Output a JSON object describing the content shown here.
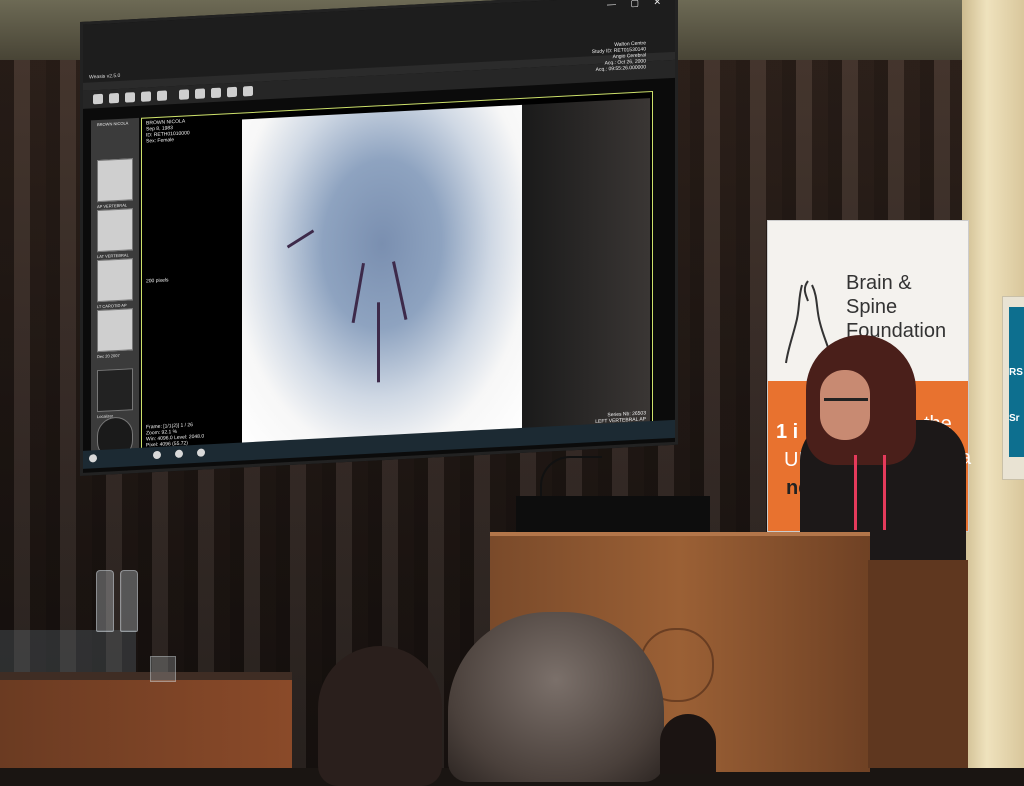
{
  "screen": {
    "app_title": "Weasis v2.5.0",
    "controls": "— ▢ ✕",
    "thumbnails": [
      {
        "label": "BROWN NICOLA"
      },
      {
        "label": "AP VERTEBRAL"
      },
      {
        "label": "LAT VERTEBRAL"
      },
      {
        "label": "LT CAROTID AP"
      },
      {
        "label": "Dec 20 2007"
      },
      {
        "label": "Localizer"
      }
    ],
    "overlay_top_left": [
      "BROWN NICOLA",
      "Sep 8, 1983",
      "ID: RETH01010000",
      "Sex: Female"
    ],
    "overlay_top_right": [
      "Walton Centre",
      "Study ID: RET01530140",
      "Angio Cerebral",
      "Acq.: Oct 26, 2000",
      "Acq.: 09:55:26.000000"
    ],
    "overlay_bottom_left": [
      "Frame: [1/1(2)] 1 / 26",
      "Zoom: 92.1 %",
      "Win: 4096.0 Level: 2048.0",
      "Pixel: 4096 (55.72)"
    ],
    "overlay_bottom_right": [
      "Series Nb: 26503",
      "LEFT VERTEBRAL AP"
    ],
    "scale_label": "200 pixels"
  },
  "banner": {
    "org_line1": "Brain & Spine",
    "org_line2": "Foundation",
    "orange_text_1": "1 i",
    "orange_text_2": "the",
    "orange_text_3": "UK",
    "orange_text_4": "a",
    "orange_text_5": "nev"
  },
  "wall_sign": {
    "line1": "RS",
    "line2": "Sr"
  },
  "colors": {
    "banner_orange": "#e8722f",
    "lanyard": "#e53a5b",
    "viewer_border": "#cde06b"
  }
}
